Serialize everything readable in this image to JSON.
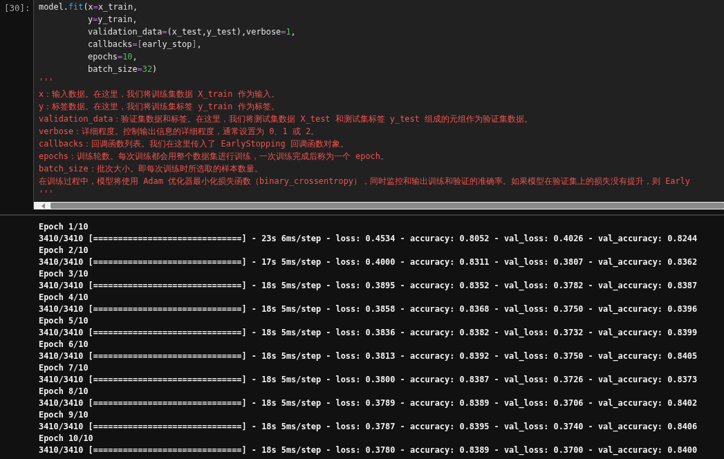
{
  "cell": {
    "prompt": "[30]:",
    "code_lines": [
      {
        "indent": false,
        "tokens": [
          {
            "kind": "name",
            "text": "model."
          },
          {
            "kind": "func",
            "text": "fit"
          },
          {
            "kind": "name",
            "text": "(x"
          },
          {
            "kind": "op",
            "text": "="
          },
          {
            "kind": "name",
            "text": "x_train,"
          }
        ]
      },
      {
        "indent": true,
        "tokens": [
          {
            "kind": "name",
            "text": "y"
          },
          {
            "kind": "op",
            "text": "="
          },
          {
            "kind": "name",
            "text": "y_train,"
          }
        ]
      },
      {
        "indent": true,
        "tokens": [
          {
            "kind": "name",
            "text": "validation_data"
          },
          {
            "kind": "op",
            "text": "="
          },
          {
            "kind": "name",
            "text": "(x_test,y_test),verbose"
          },
          {
            "kind": "op",
            "text": "="
          },
          {
            "kind": "num",
            "text": "1"
          },
          {
            "kind": "name",
            "text": ","
          }
        ]
      },
      {
        "indent": true,
        "tokens": [
          {
            "kind": "name",
            "text": "callbacks"
          },
          {
            "kind": "op",
            "text": "="
          },
          {
            "kind": "bracket",
            "text": "["
          },
          {
            "kind": "name",
            "text": "early_stop"
          },
          {
            "kind": "bracket",
            "text": "]"
          },
          {
            "kind": "name",
            "text": ","
          }
        ]
      },
      {
        "indent": true,
        "tokens": [
          {
            "kind": "name",
            "text": "epochs"
          },
          {
            "kind": "op",
            "text": "="
          },
          {
            "kind": "num",
            "text": "10"
          },
          {
            "kind": "name",
            "text": ","
          }
        ]
      },
      {
        "indent": true,
        "tokens": [
          {
            "kind": "name",
            "text": "batch_size"
          },
          {
            "kind": "op",
            "text": "="
          },
          {
            "kind": "num",
            "text": "32"
          },
          {
            "kind": "name",
            "text": ")"
          }
        ]
      }
    ],
    "docstring_lines": [
      "'''",
      "x：输入数据。在这里，我们将训练集数据 X_train 作为输入。",
      "y：标签数据。在这里，我们将训练集标签 y_train 作为标签。",
      "validation_data：验证集数据和标签。在这里，我们将测试集数据 X_test 和测试集标签 y_test 组成的元组作为验证集数据。",
      "verbose：详细程度。控制输出信息的详细程度，通常设置为 0、1 或 2。",
      "callbacks：回调函数列表。我们在这里传入了 EarlyStopping 回调函数对象。",
      "epochs：训练轮数。每次训练都会用整个数据集进行训练，一次训练完成后称为一个 epoch。",
      "batch_size：批次大小。即每次训练时所选取的样本数量。",
      "在训练过程中，模型将使用 Adam 优化器最小化损失函数（binary_crossentropy），同时监控和输出训练和验证的准确率。如果模型在验证集上的损失没有提升，则 Early",
      "'''"
    ]
  },
  "output_lines": [
    "Epoch 1/10",
    "3410/3410 [==============================] - 23s 6ms/step - loss: 0.4534 - accuracy: 0.8052 - val_loss: 0.4026 - val_accuracy: 0.8244",
    "Epoch 2/10",
    "3410/3410 [==============================] - 17s 5ms/step - loss: 0.4000 - accuracy: 0.8311 - val_loss: 0.3807 - val_accuracy: 0.8362",
    "Epoch 3/10",
    "3410/3410 [==============================] - 18s 5ms/step - loss: 0.3895 - accuracy: 0.8352 - val_loss: 0.3782 - val_accuracy: 0.8387",
    "Epoch 4/10",
    "3410/3410 [==============================] - 18s 5ms/step - loss: 0.3858 - accuracy: 0.8368 - val_loss: 0.3750 - val_accuracy: 0.8396",
    "Epoch 5/10",
    "3410/3410 [==============================] - 18s 5ms/step - loss: 0.3836 - accuracy: 0.8382 - val_loss: 0.3732 - val_accuracy: 0.8399",
    "Epoch 6/10",
    "3410/3410 [==============================] - 18s 5ms/step - loss: 0.3813 - accuracy: 0.8392 - val_loss: 0.3750 - val_accuracy: 0.8405",
    "Epoch 7/10",
    "3410/3410 [==============================] - 18s 5ms/step - loss: 0.3800 - accuracy: 0.8387 - val_loss: 0.3726 - val_accuracy: 0.8373",
    "Epoch 8/10",
    "3410/3410 [==============================] - 18s 5ms/step - loss: 0.3789 - accuracy: 0.8389 - val_loss: 0.3706 - val_accuracy: 0.8402",
    "Epoch 9/10",
    "3410/3410 [==============================] - 18s 5ms/step - loss: 0.3787 - accuracy: 0.8395 - val_loss: 0.3740 - val_accuracy: 0.8406",
    "Epoch 10/10",
    "3410/3410 [==============================] - 18s 5ms/step - loss: 0.3780 - accuracy: 0.8389 - val_loss: 0.3700 - val_accuracy: 0.8400"
  ]
}
